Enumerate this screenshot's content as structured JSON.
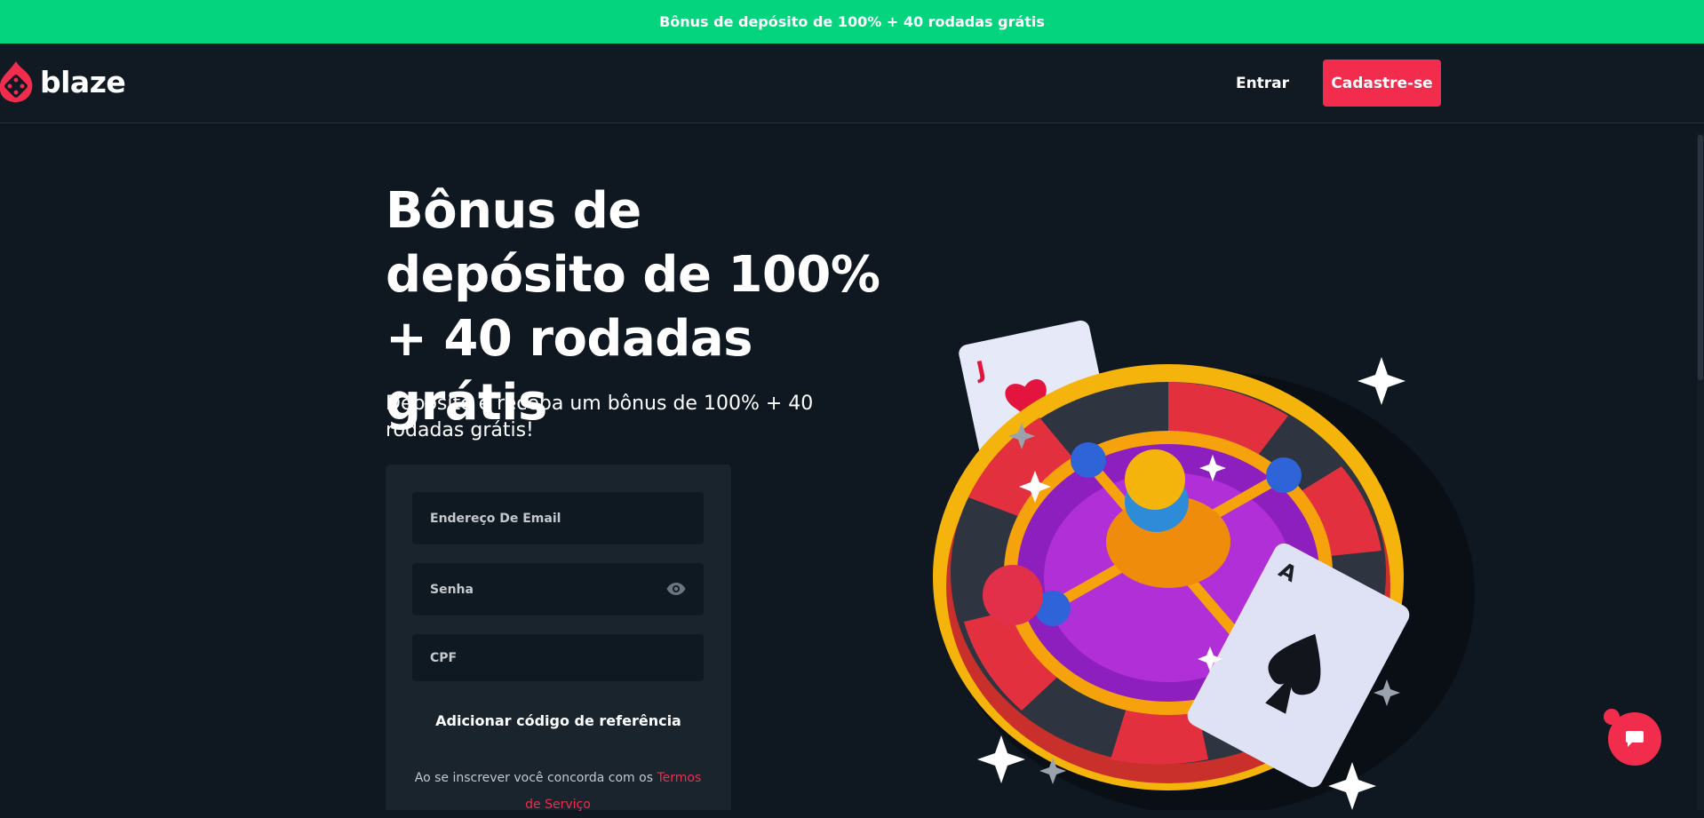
{
  "promo_banner": {
    "text": "Bônus de depósito de 100% + 40 rodadas grátis"
  },
  "header": {
    "logo_text": "blaze",
    "login_label": "Entrar",
    "signup_label": "Cadastre-se"
  },
  "hero": {
    "title": "Bônus de depósito de 100% + 40 rodadas grátis",
    "subtitle": "Deposite e receba um bônus de 100% + 40 rodadas grátis!"
  },
  "form": {
    "email_placeholder": "Endereço De Email",
    "password_placeholder": "Senha",
    "cpf_placeholder": "CPF",
    "referral_label": "Adicionar código de referência",
    "terms_prefix": "Ao se inscrever você concorda com os",
    "terms_link": "Termos de Serviço"
  },
  "illustration": {
    "card_top_rank": "J",
    "card_bottom_rank": "A"
  },
  "icons": {
    "logo": "blaze-flame-dice-icon",
    "password_toggle": "eye-icon",
    "chat": "chat-bubble-icon"
  },
  "colors": {
    "promo_green": "#05d47f",
    "brand_red": "#f12c4c",
    "background": "#0f1821",
    "card": "#1a242d"
  }
}
